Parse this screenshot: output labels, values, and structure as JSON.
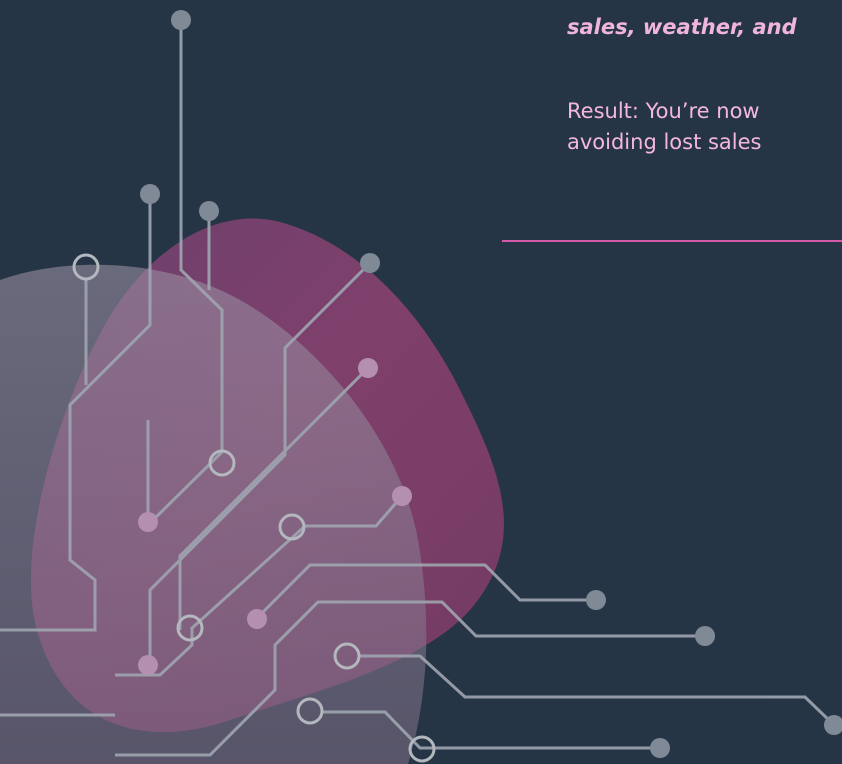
{
  "slide": {
    "quote_line": "sales, weather, and",
    "result_line_1": "Result: You’re now",
    "result_line_2": "avoiding lost sales"
  },
  "colors": {
    "background": "#263545",
    "quote_text": "#f0b5dd",
    "result_text": "#f4b8e0",
    "divider": "#d45aa8",
    "circuit": "#9aa3ad",
    "blob_purple": "#7e3f6b",
    "blob_gray": "#8e8298"
  },
  "decoration": {
    "artwork_icon": "circuit-board-icon"
  }
}
